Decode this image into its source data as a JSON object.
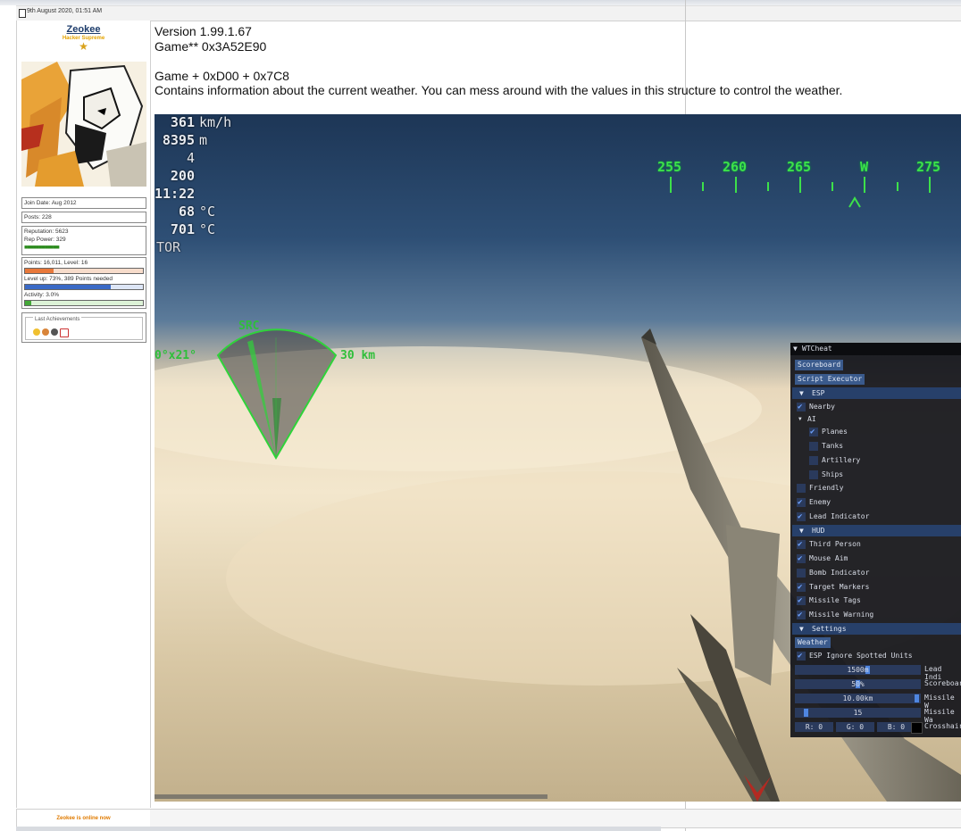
{
  "post_header": {
    "date": "9th August 2020, 01:51 AM"
  },
  "user": {
    "name": "Zeokee",
    "title": "Hacker Supreme",
    "join_date": "Join Date: Aug 2012",
    "posts": "Posts: 228",
    "reputation": "Reputation: 5623",
    "rep_power": "Rep Power: 329",
    "points_level": "Points: 16,011, Level: 16",
    "points_progress": 0.24,
    "levelup": "Level up: 73%, 389 Points needed",
    "levelup_progress": 0.73,
    "activity": "Activity: 3.0%",
    "activity_progress": 0.03,
    "achievements_label": "Last Achievements",
    "online_status": "Zeokee is online now"
  },
  "post": {
    "line1": "Version 1.99.1.67",
    "line2": "Game** 0x3A52E90",
    "line3": "Game + 0xD00 + 0x7C8",
    "line4": "Contains information about the current weather. You can mess around with the values in this structure to control the weather."
  },
  "hud": {
    "speed": "361",
    "speed_unit": "km/h",
    "altitude": "8395",
    "altitude_unit": "m",
    "gear": "4",
    "throttle": "200",
    "time": "11:22",
    "temp1": "68",
    "temp1_unit": "°C",
    "temp2": "701",
    "temp2_unit": "°C",
    "mode": "TOR",
    "compass": [
      "255",
      "260",
      "265",
      "W",
      "275"
    ],
    "radar_label": "SRC",
    "radar_angle": "0°x21°",
    "radar_range": "30 km"
  },
  "cheat_menu": {
    "title": "WTCheat",
    "scoreboard_btn": "Scoreboard",
    "script_btn": "Script Executor",
    "esp_header": "ESP",
    "nearby": "Nearby",
    "ai": "AI",
    "planes": "Planes",
    "tanks": "Tanks",
    "artillery": "Artillery",
    "ships": "Ships",
    "friendly": "Friendly",
    "enemy": "Enemy",
    "lead_indicator": "Lead Indicator",
    "hud_header": "HUD",
    "third_person": "Third Person",
    "mouse_aim": "Mouse Aim",
    "bomb_indicator": "Bomb Indicator",
    "target_markers": "Target Markers",
    "missile_tags": "Missile Tags",
    "missile_warning": "Missile Warning",
    "settings_header": "Settings",
    "weather_btn": "Weather",
    "esp_ignore": "ESP Ignore Spotted Units",
    "sliders": [
      {
        "value": "1500m",
        "label": "Lead Indi"
      },
      {
        "value": "50%",
        "label": "Scoreboar"
      },
      {
        "value": "10.00km",
        "label": "Missile W"
      },
      {
        "value": "15",
        "label": "Missile Wa"
      }
    ],
    "color_r": "R:  0",
    "color_g": "G:  0",
    "color_b": "B:  0",
    "crosshair": "Crosshair"
  }
}
